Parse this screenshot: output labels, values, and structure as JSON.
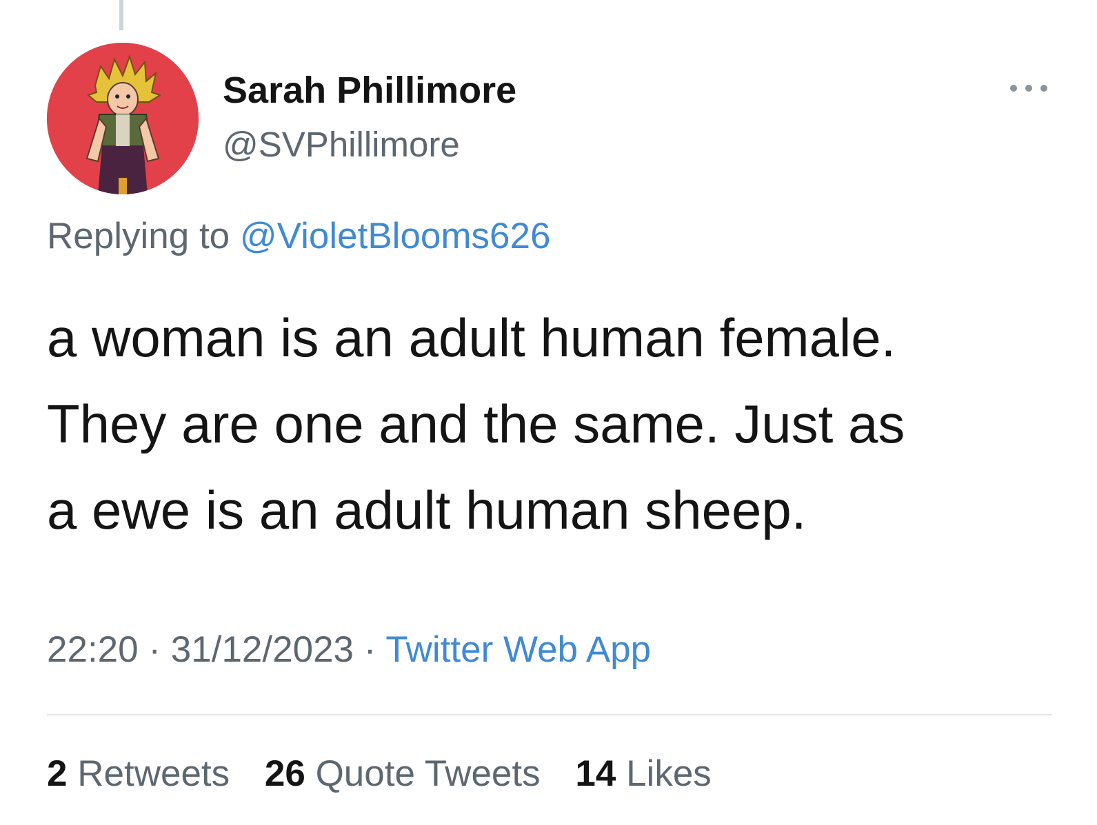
{
  "tweet": {
    "author": {
      "display_name": "Sarah Phillimore",
      "handle": "@SVPhillimore"
    },
    "replying_prefix": "Replying to",
    "replying_to": "@VioletBlooms626",
    "text_lines": [
      "a woman is an adult human female.",
      "They are one and the same. Just as",
      "a ewe is an adult human sheep."
    ],
    "time": "22:20",
    "separator": "·",
    "date": "31/12/2023",
    "source": "Twitter Web App",
    "stats": {
      "retweets_count": "2",
      "retweets_label": "Retweets",
      "quote_tweets_count": "26",
      "quote_tweets_label": "Quote Tweets",
      "likes_count": "14",
      "likes_label": "Likes"
    },
    "more_icon": "more-horizontal-icon"
  },
  "colors": {
    "avatar_bg": "#e3414a",
    "link": "#3f8ad2",
    "secondary_text": "#5d6770",
    "primary_text": "#141414",
    "divider": "#e3e6e9"
  }
}
